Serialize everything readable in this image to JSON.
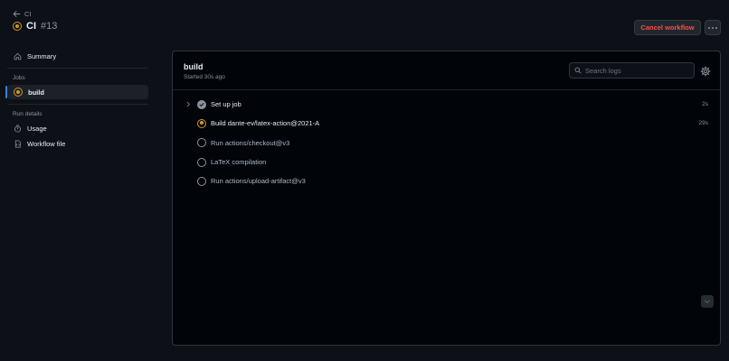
{
  "header": {
    "back_label": "CI",
    "title": "CI",
    "run_number": "#13",
    "cancel_label": "Cancel workflow"
  },
  "sidebar": {
    "summary_label": "Summary",
    "jobs_heading": "Jobs",
    "job_label": "build",
    "run_details_heading": "Run details",
    "usage_label": "Usage",
    "workflow_file_label": "Workflow file"
  },
  "job": {
    "name": "build",
    "started": "Started 30s ago",
    "search_placeholder": "Search logs",
    "steps": [
      {
        "label": "Set up job",
        "status": "success",
        "duration": "2s"
      },
      {
        "label": "Build dante-ev/latex-action@2021-A",
        "status": "in-progress",
        "duration": "29s"
      },
      {
        "label": "Run actions/checkout@v3",
        "status": "queued",
        "duration": ""
      },
      {
        "label": "LaTeX compilation",
        "status": "queued",
        "duration": ""
      },
      {
        "label": "Run actions/upload-artifact@v3",
        "status": "queued",
        "duration": ""
      }
    ]
  },
  "colors": {
    "background": "#0d1117",
    "panel": "#010409",
    "in_progress": "#d29922",
    "danger": "#f85149",
    "accent": "#2f81f7"
  }
}
